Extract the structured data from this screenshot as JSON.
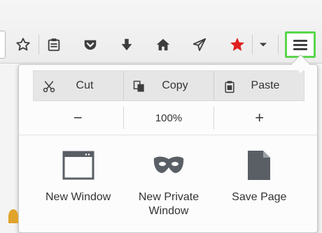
{
  "toolbar": {
    "buttons": [
      {
        "name": "bookmark-star-icon"
      },
      {
        "name": "reading-list-icon"
      },
      {
        "name": "pocket-icon"
      },
      {
        "name": "download-arrow-icon"
      },
      {
        "name": "home-icon"
      },
      {
        "name": "send-plane-icon"
      },
      {
        "name": "red-star-addon-icon"
      },
      {
        "name": "dropdown-caret-icon"
      }
    ],
    "menu_button": {
      "name": "hamburger-menu-icon",
      "highlight_color": "#59d64c"
    }
  },
  "panel": {
    "edit": {
      "cut": "Cut",
      "copy": "Copy",
      "paste": "Paste"
    },
    "zoom": {
      "minus": "−",
      "level": "100%",
      "plus": "+"
    },
    "items": [
      {
        "icon": "new-window-icon",
        "label": "New Window"
      },
      {
        "icon": "private-mask-icon",
        "label": "New Private\nWindow"
      },
      {
        "icon": "save-page-icon",
        "label": "Save Page"
      }
    ]
  }
}
